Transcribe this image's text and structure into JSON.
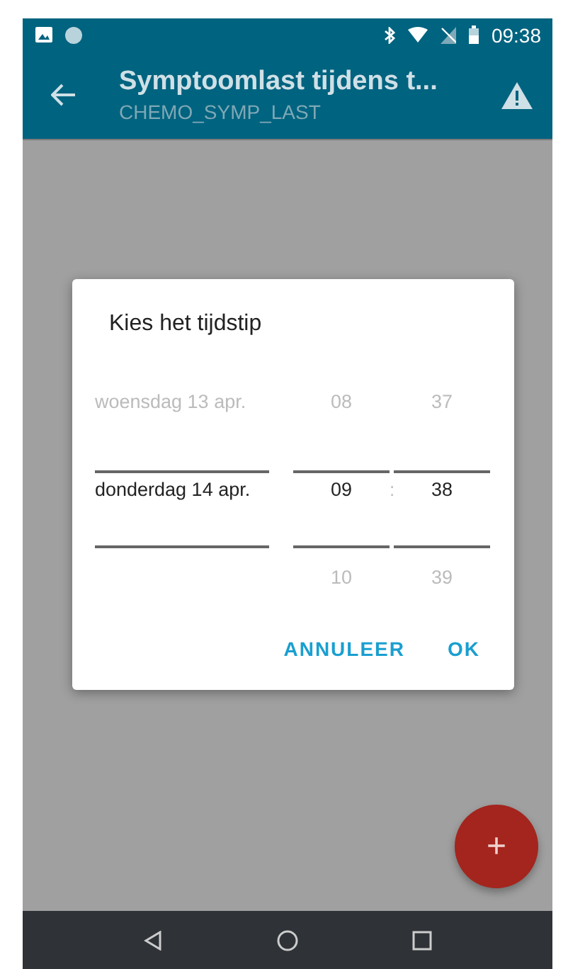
{
  "status_bar": {
    "time": "09:38"
  },
  "app_bar": {
    "title": "Symptoomlast tijdens t...",
    "subtitle": "CHEMO_SYMP_LAST"
  },
  "dialog": {
    "title": "Kies het tijdstip",
    "date_column": [
      {
        "text": "woensdag 13 apr.",
        "selected": false
      },
      {
        "text": "donderdag 14 apr.",
        "selected": true
      }
    ],
    "hour_column": [
      {
        "text": "08",
        "selected": false
      },
      {
        "text": "09",
        "selected": true
      },
      {
        "text": "10",
        "selected": false
      }
    ],
    "separator": ":",
    "minute_column": [
      {
        "text": "37",
        "selected": false
      },
      {
        "text": "38",
        "selected": true
      },
      {
        "text": "39",
        "selected": false
      }
    ],
    "buttons": [
      "ANNULEER",
      "OK"
    ]
  },
  "fab": {
    "label": "+"
  }
}
